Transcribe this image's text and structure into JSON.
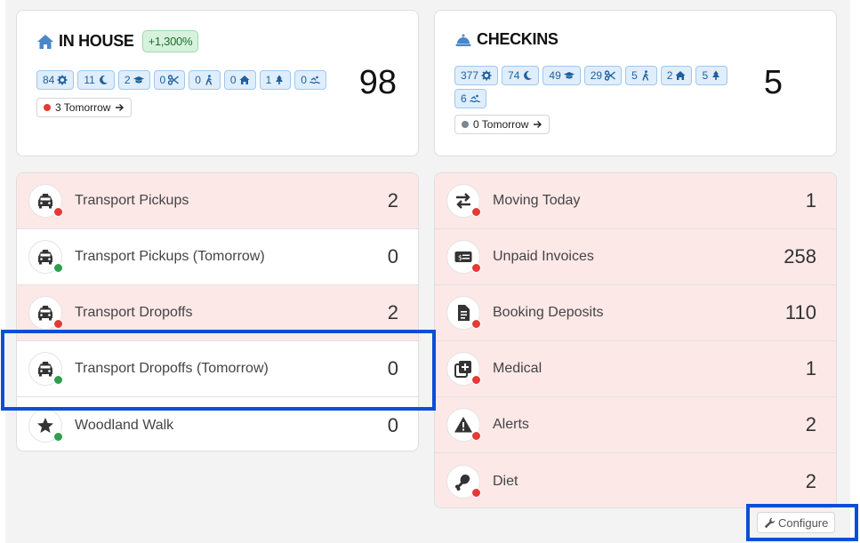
{
  "inhouse": {
    "title": "IN HOUSE",
    "badge": "+1,300%",
    "count": "98",
    "tomorrow": "3 Tomorrow",
    "chips": [
      {
        "value": "84",
        "icon": "gear-icon"
      },
      {
        "value": "11",
        "icon": "moon-icon"
      },
      {
        "value": "2",
        "icon": "graduation-cap-icon"
      },
      {
        "value": "0",
        "icon": "scissors-icon"
      },
      {
        "value": "0",
        "icon": "walking-person-icon"
      },
      {
        "value": "0",
        "icon": "home-icon"
      },
      {
        "value": "1",
        "icon": "tree-icon"
      },
      {
        "value": "0",
        "icon": "swimmer-icon"
      }
    ]
  },
  "checkins": {
    "title": "CHECKINS",
    "count": "5",
    "tomorrow": "0 Tomorrow",
    "chips": [
      {
        "value": "377",
        "icon": "gear-icon"
      },
      {
        "value": "74",
        "icon": "moon-icon"
      },
      {
        "value": "49",
        "icon": "graduation-cap-icon"
      },
      {
        "value": "29",
        "icon": "scissors-icon"
      },
      {
        "value": "5",
        "icon": "walking-person-icon"
      },
      {
        "value": "2",
        "icon": "home-icon"
      },
      {
        "value": "5",
        "icon": "tree-icon"
      },
      {
        "value": "6",
        "icon": "swimmer-icon"
      }
    ]
  },
  "left_list": [
    {
      "label": "Transport Pickups",
      "count": "2"
    },
    {
      "label": "Transport Pickups (Tomorrow)",
      "count": "0"
    },
    {
      "label": "Transport Dropoffs",
      "count": "2"
    },
    {
      "label": "Transport Dropoffs (Tomorrow)",
      "count": "0"
    },
    {
      "label": "Woodland Walk",
      "count": "0"
    }
  ],
  "right_list": [
    {
      "label": "Moving Today",
      "count": "1"
    },
    {
      "label": "Unpaid Invoices",
      "count": "258"
    },
    {
      "label": "Booking Deposits",
      "count": "110"
    },
    {
      "label": "Medical",
      "count": "1"
    },
    {
      "label": "Alerts",
      "count": "2"
    },
    {
      "label": "Diet",
      "count": "2"
    }
  ],
  "configure_label": "Configure",
  "colors": {
    "accent_blue": "#0b4fd6",
    "alert_row": "#fde8e8",
    "chip_bg": "#dfeefc",
    "status_red": "#e53935",
    "status_green": "#2e9e4f"
  }
}
